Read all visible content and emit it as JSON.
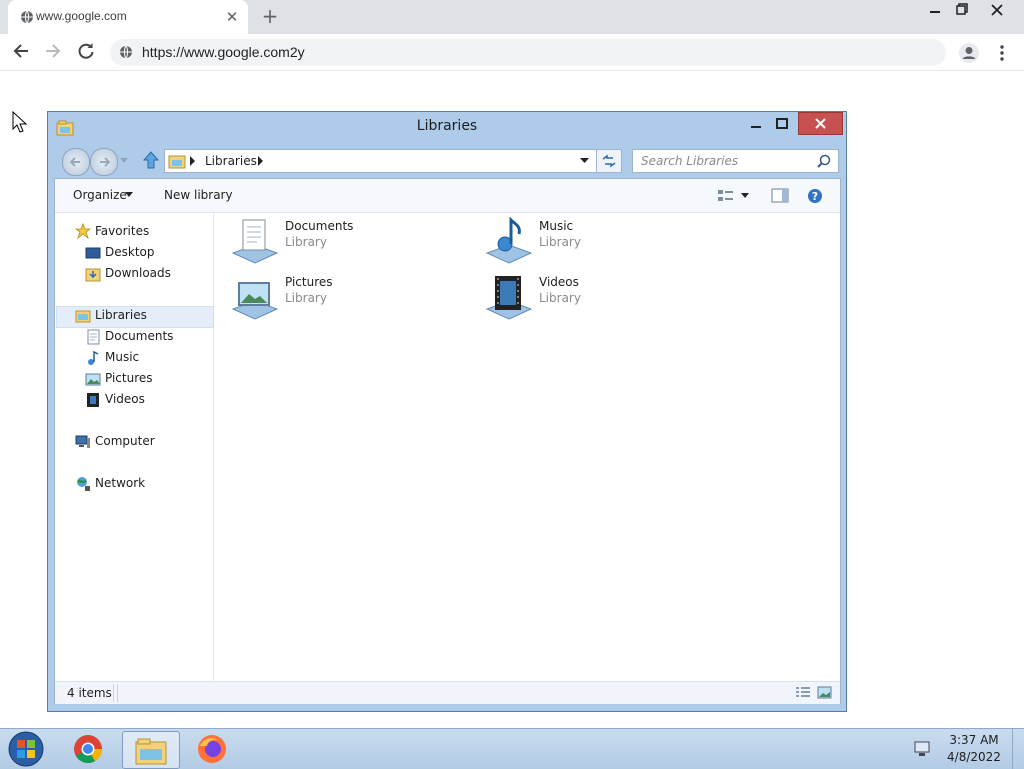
{
  "browser": {
    "tab_title": "www.google.com",
    "url": "https://www.google.com2y",
    "new_tab_label": "+",
    "close_tab_label": "✕"
  },
  "explorer": {
    "title": "Libraries",
    "address_segment": "Libraries",
    "search_placeholder": "Search Libraries",
    "toolbar": {
      "organize": "Organize",
      "new_library": "New library"
    },
    "nav": {
      "favorites": "Favorites",
      "favorites_items": [
        "Desktop",
        "Downloads"
      ],
      "libraries": "Libraries",
      "libraries_items": [
        "Documents",
        "Music",
        "Pictures",
        "Videos"
      ],
      "computer": "Computer",
      "network": "Network"
    },
    "libraries": [
      {
        "name": "Documents",
        "type": "Library"
      },
      {
        "name": "Music",
        "type": "Library"
      },
      {
        "name": "Pictures",
        "type": "Library"
      },
      {
        "name": "Videos",
        "type": "Library"
      }
    ],
    "status": "4 items"
  },
  "taskbar": {
    "time": "3:37 AM",
    "date": "4/8/2022"
  },
  "colors": {
    "explorer_frame": "#aecbea",
    "close_button": "#c75050",
    "selection": "#e5eef8"
  }
}
